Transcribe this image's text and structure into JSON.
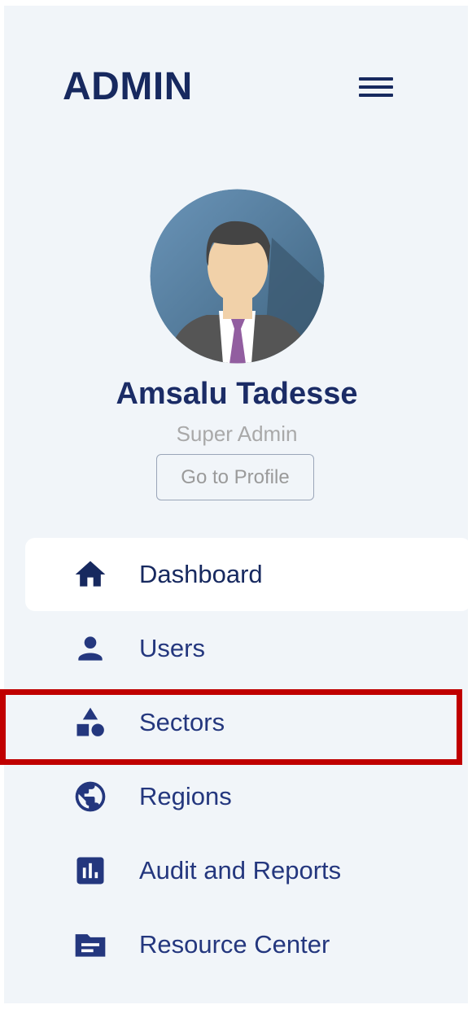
{
  "header": {
    "title": "ADMIN",
    "menu_icon": "hamburger-icon"
  },
  "profile": {
    "name": "Amsalu Tadesse",
    "role": "Super Admin",
    "button_label": "Go to Profile"
  },
  "menu": {
    "items": [
      {
        "label": "Dashboard",
        "icon": "home-icon",
        "active": true
      },
      {
        "label": "Users",
        "icon": "user-icon"
      },
      {
        "label": "Sectors",
        "icon": "shapes-icon"
      },
      {
        "label": "Regions",
        "icon": "globe-icon"
      },
      {
        "label": "Audit and Reports",
        "icon": "bar-chart-icon"
      },
      {
        "label": "Resource Center",
        "icon": "folder-icon"
      }
    ]
  },
  "colors": {
    "accent": "#24377e",
    "panel_bg": "#f1f5f9",
    "highlight": "#c00000"
  }
}
